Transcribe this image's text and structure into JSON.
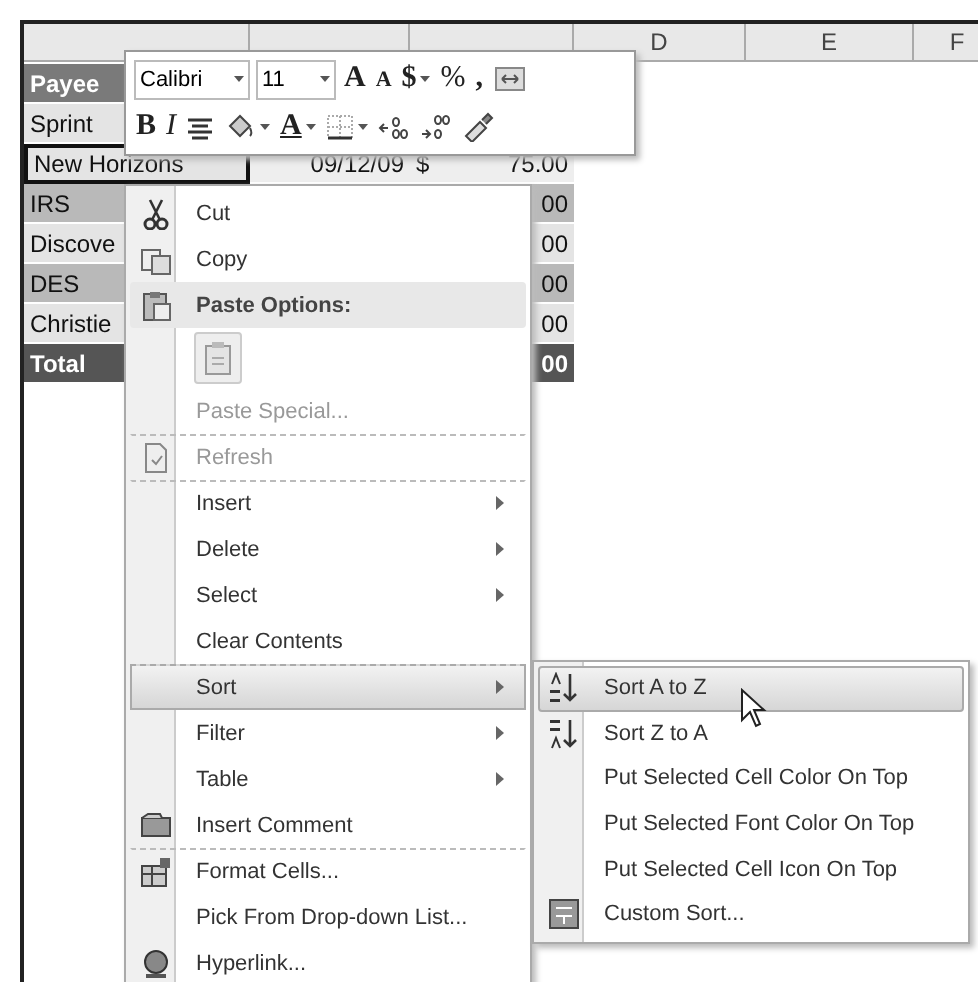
{
  "columns": [
    {
      "label": "D"
    },
    {
      "label": "E"
    },
    {
      "label": "F"
    }
  ],
  "rows": [
    {
      "kind": "header",
      "payee": "Payee"
    },
    {
      "kind": "light",
      "payee": "Sprint"
    },
    {
      "kind": "active",
      "payee": "New Horizons",
      "date": "09/12/09",
      "currency": "$",
      "amount": "75.00"
    },
    {
      "kind": "dark",
      "payee": "IRS",
      "amount": "00"
    },
    {
      "kind": "light",
      "payee": "Discove",
      "amount": "00"
    },
    {
      "kind": "dark",
      "payee": "DES",
      "amount": "00"
    },
    {
      "kind": "light",
      "payee": "Christie",
      "amount": "00"
    },
    {
      "kind": "total",
      "payee": "Total",
      "amount": "00"
    }
  ],
  "mini_toolbar": {
    "font": "Calibri",
    "size": "11",
    "row_1": [
      {
        "kind": "grow",
        "text": "A"
      },
      {
        "kind": "shrink",
        "text": "A"
      },
      {
        "kind": "currency",
        "text": "$",
        "dropdown": true
      },
      {
        "kind": "percent",
        "text": "%",
        "dropdown": false
      },
      {
        "kind": "comma",
        "text": ",",
        "dropdown": false
      },
      {
        "kind": "merge",
        "dropdown": false
      }
    ],
    "row_2": [
      {
        "kind": "bold",
        "text": "B",
        "dropdown": false
      },
      {
        "kind": "italic",
        "text": "I",
        "dropdown": false
      },
      {
        "kind": "center",
        "dropdown": false
      },
      {
        "kind": "fill",
        "dropdown": true
      },
      {
        "kind": "font-color",
        "text": "A",
        "dropdown": true
      },
      {
        "kind": "borders",
        "dropdown": true
      },
      {
        "kind": "inc-decimal",
        "dropdown": false
      },
      {
        "kind": "dec-decimal",
        "dropdown": false
      },
      {
        "kind": "painter",
        "dropdown": false
      }
    ]
  },
  "context_menu": [
    {
      "kind": "command",
      "label": "Cut",
      "disabled": false,
      "submenu": false,
      "selected": false
    },
    {
      "kind": "command",
      "label": "Copy",
      "disabled": false,
      "submenu": false,
      "selected": false
    },
    {
      "kind": "heading",
      "label": "Paste Options:"
    },
    {
      "kind": "paste-buttons"
    },
    {
      "kind": "command",
      "label": "Paste Special...",
      "disabled": true,
      "submenu": false,
      "selected": false
    },
    {
      "kind": "command",
      "label": "Refresh",
      "disabled": true,
      "submenu": false,
      "selected": false,
      "divider_above": true
    },
    {
      "kind": "command",
      "label": "Insert",
      "disabled": false,
      "submenu": true,
      "selected": false,
      "divider_above": true
    },
    {
      "kind": "command",
      "label": "Delete",
      "disabled": false,
      "submenu": true,
      "selected": false
    },
    {
      "kind": "command",
      "label": "Select",
      "disabled": false,
      "submenu": true,
      "selected": false
    },
    {
      "kind": "command",
      "label": "Clear Contents",
      "disabled": false,
      "submenu": false,
      "selected": false
    },
    {
      "kind": "command",
      "label": "Sort",
      "disabled": false,
      "submenu": true,
      "selected": true,
      "divider_above": true
    },
    {
      "kind": "command",
      "label": "Filter",
      "disabled": false,
      "submenu": true,
      "selected": false
    },
    {
      "kind": "command",
      "label": "Table",
      "disabled": false,
      "submenu": true,
      "selected": false
    },
    {
      "kind": "command",
      "label": "Insert Comment",
      "disabled": false,
      "submenu": false,
      "selected": false
    },
    {
      "kind": "command",
      "label": "Format Cells...",
      "disabled": false,
      "submenu": false,
      "selected": false,
      "divider_above": true
    },
    {
      "kind": "command",
      "label": "Pick From Drop-down List...",
      "disabled": false,
      "submenu": false,
      "selected": false
    },
    {
      "kind": "command",
      "label": "Hyperlink...",
      "disabled": false,
      "submenu": false,
      "selected": false
    }
  ],
  "sort_submenu": [
    {
      "label": "Sort A to Z",
      "selected": true
    },
    {
      "label": "Sort Z to A",
      "selected": false
    },
    {
      "label": "Put Selected Cell Color On Top",
      "selected": false
    },
    {
      "label": "Put Selected Font Color On Top",
      "selected": false
    },
    {
      "label": "Put Selected Cell Icon On Top",
      "selected": false
    },
    {
      "label": "Custom Sort...",
      "selected": false
    }
  ]
}
